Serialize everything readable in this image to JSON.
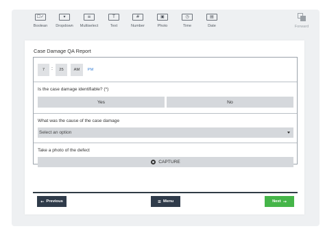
{
  "toolbar": {
    "items": [
      {
        "label": "Boolean",
        "icon": "boolean-icon",
        "glyph": "☐✓"
      },
      {
        "label": "Dropdown",
        "icon": "dropdown-icon",
        "glyph": "▾"
      },
      {
        "label": "Multiselect",
        "icon": "multiselect-icon",
        "glyph": "≡"
      },
      {
        "label": "Text",
        "icon": "text-icon",
        "glyph": "T"
      },
      {
        "label": "Number",
        "icon": "number-icon",
        "glyph": "#"
      },
      {
        "label": "Photo",
        "icon": "photo-icon",
        "glyph": "▣"
      },
      {
        "label": "Time",
        "icon": "time-icon",
        "glyph": "◷"
      },
      {
        "label": "Date",
        "icon": "date-icon",
        "glyph": "▤"
      }
    ],
    "forward_label": "Forward"
  },
  "form": {
    "title": "Case Damage QA Report",
    "time": {
      "hour": "7",
      "separator": ":",
      "minute": "25",
      "am": "AM",
      "pm": "PM",
      "selected": "PM"
    },
    "q1": {
      "label": "Is the case damage identifiable? (*)",
      "yes": "Yes",
      "no": "No"
    },
    "q2": {
      "label": "What was the cause of the case damage",
      "placeholder": "Select an option"
    },
    "q3": {
      "label": "Take a photo of the defect",
      "capture": "CAPTURE"
    }
  },
  "nav": {
    "previous": "Previous",
    "menu": "Menu",
    "next": "Next"
  },
  "colors": {
    "nav_dark": "#2f3b4a",
    "next_green": "#45b549",
    "pm_selected": "#3b82d6"
  }
}
